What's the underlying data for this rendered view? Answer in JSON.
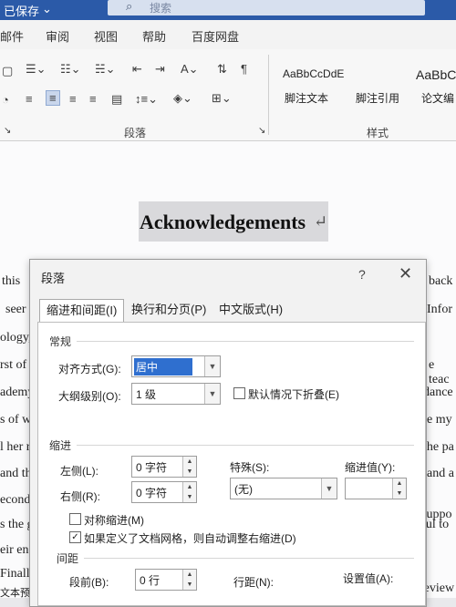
{
  "titlebar": {
    "saved_status": "已保存",
    "search_placeholder": "搜索"
  },
  "menu": {
    "mail": "邮件",
    "review": "审阅",
    "view": "视图",
    "help": "帮助",
    "baidu": "百度网盘"
  },
  "ribbon": {
    "paragraph_group": "段落",
    "styles_group": "样式",
    "styles": [
      {
        "preview": "AaBbCcDdE",
        "name": "脚注文本"
      },
      {
        "preview": "",
        "name": "脚注引用"
      },
      {
        "preview": "AaBbC",
        "name": "论文编"
      }
    ]
  },
  "document": {
    "heading": "Acknowledgements",
    "left_fragments": [
      "this",
      "seer",
      "ology,",
      "rst of",
      "ademy",
      "s of w",
      "l her r",
      "and tha",
      "econd",
      "s the g",
      "eir enc",
      "Finally,",
      "文本预测:"
    ],
    "right_fragments": [
      "back",
      "Infor",
      "e teac",
      "dance",
      "e my",
      "the pa",
      "and a",
      "l suppo",
      "eful to",
      "e review"
    ]
  },
  "dialog": {
    "title": "段落",
    "help": "?",
    "tabs": [
      "缩进和间距(I)",
      "换行和分页(P)",
      "中文版式(H)"
    ],
    "general": {
      "section": "常规",
      "alignment_label": "对齐方式(G):",
      "alignment_value": "居中",
      "outline_label": "大纲级别(O):",
      "outline_value": "1 级",
      "collapse_label": "默认情况下折叠(E)"
    },
    "indent": {
      "section": "缩进",
      "left_label": "左侧(L):",
      "left_value": "0 字符",
      "right_label": "右侧(R):",
      "right_value": "0 字符",
      "special_label": "特殊(S):",
      "special_value": "(无)",
      "indent_value_label": "缩进值(Y):",
      "mirror_label": "对称缩进(M)",
      "auto_adjust_label": "如果定义了文档网格，则自动调整右缩进(D)"
    },
    "spacing": {
      "section": "间距",
      "before_label": "段前(B):",
      "before_value": "0 行",
      "line_spacing_label": "行距(N):",
      "at_label": "设置值(A):"
    }
  }
}
